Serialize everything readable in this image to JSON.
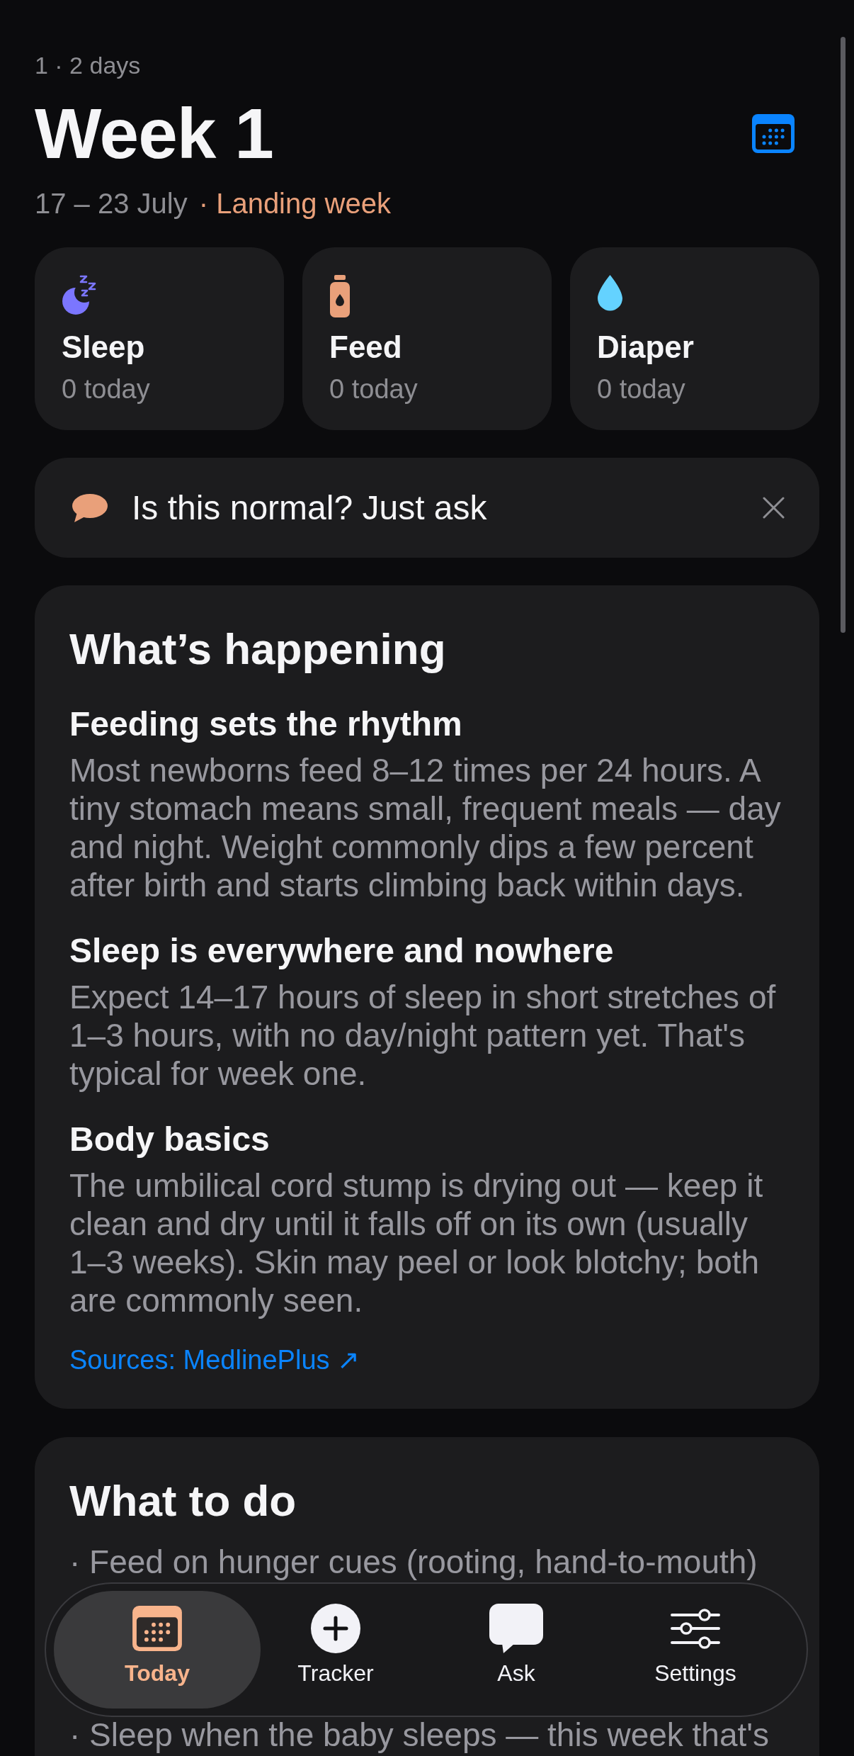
{
  "header": {
    "age": "1 · 2 days",
    "title": "Week 1",
    "date_range": "17 – 23 July",
    "week_label": "· Landing week"
  },
  "stat_cards": [
    {
      "kind": "sleep",
      "label": "Sleep",
      "count": "0 today",
      "color": "#7b76ff"
    },
    {
      "kind": "feed",
      "label": "Feed",
      "count": "0 today",
      "color": "#e9a07a"
    },
    {
      "kind": "diaper",
      "label": "Diaper",
      "count": "0 today",
      "color": "#64d2ff"
    }
  ],
  "ask_banner": {
    "text": "Is this normal? Just ask"
  },
  "whats_happening": {
    "title": "What’s happening",
    "sections": [
      {
        "heading": "Feeding sets the rhythm",
        "body": "Most newborns feed 8–12 times per 24 hours. A tiny stomach means small, frequent meals — day and night. Weight commonly dips a few percent after birth and starts climbing back within days."
      },
      {
        "heading": "Sleep is everywhere and nowhere",
        "body": "Expect 14–17 hours of sleep in short stretches of 1–3 hours, with no day/night pattern yet. That's typical for week one."
      },
      {
        "heading": "Body basics",
        "body": "The umbilical cord stump is drying out — keep it clean and dry until it falls off on its own (usually 1–3 weeks). Skin may peel or look blotchy; both are commonly seen."
      }
    ],
    "sources_link": "Sources: MedlinePlus ↗"
  },
  "what_to_do": {
    "title": "What to do",
    "items": [
      "· Feed on hunger cues (rooting, hand-to-mouth)",
      "· Sleep when the baby sleeps — this week that's"
    ]
  },
  "tab_bar": {
    "tabs": [
      {
        "kind": "today",
        "label": "Today",
        "selected": true
      },
      {
        "kind": "tracker",
        "label": "Tracker",
        "selected": false
      },
      {
        "kind": "ask",
        "label": "Ask",
        "selected": false
      },
      {
        "kind": "settings",
        "label": "Settings",
        "selected": false
      }
    ]
  }
}
